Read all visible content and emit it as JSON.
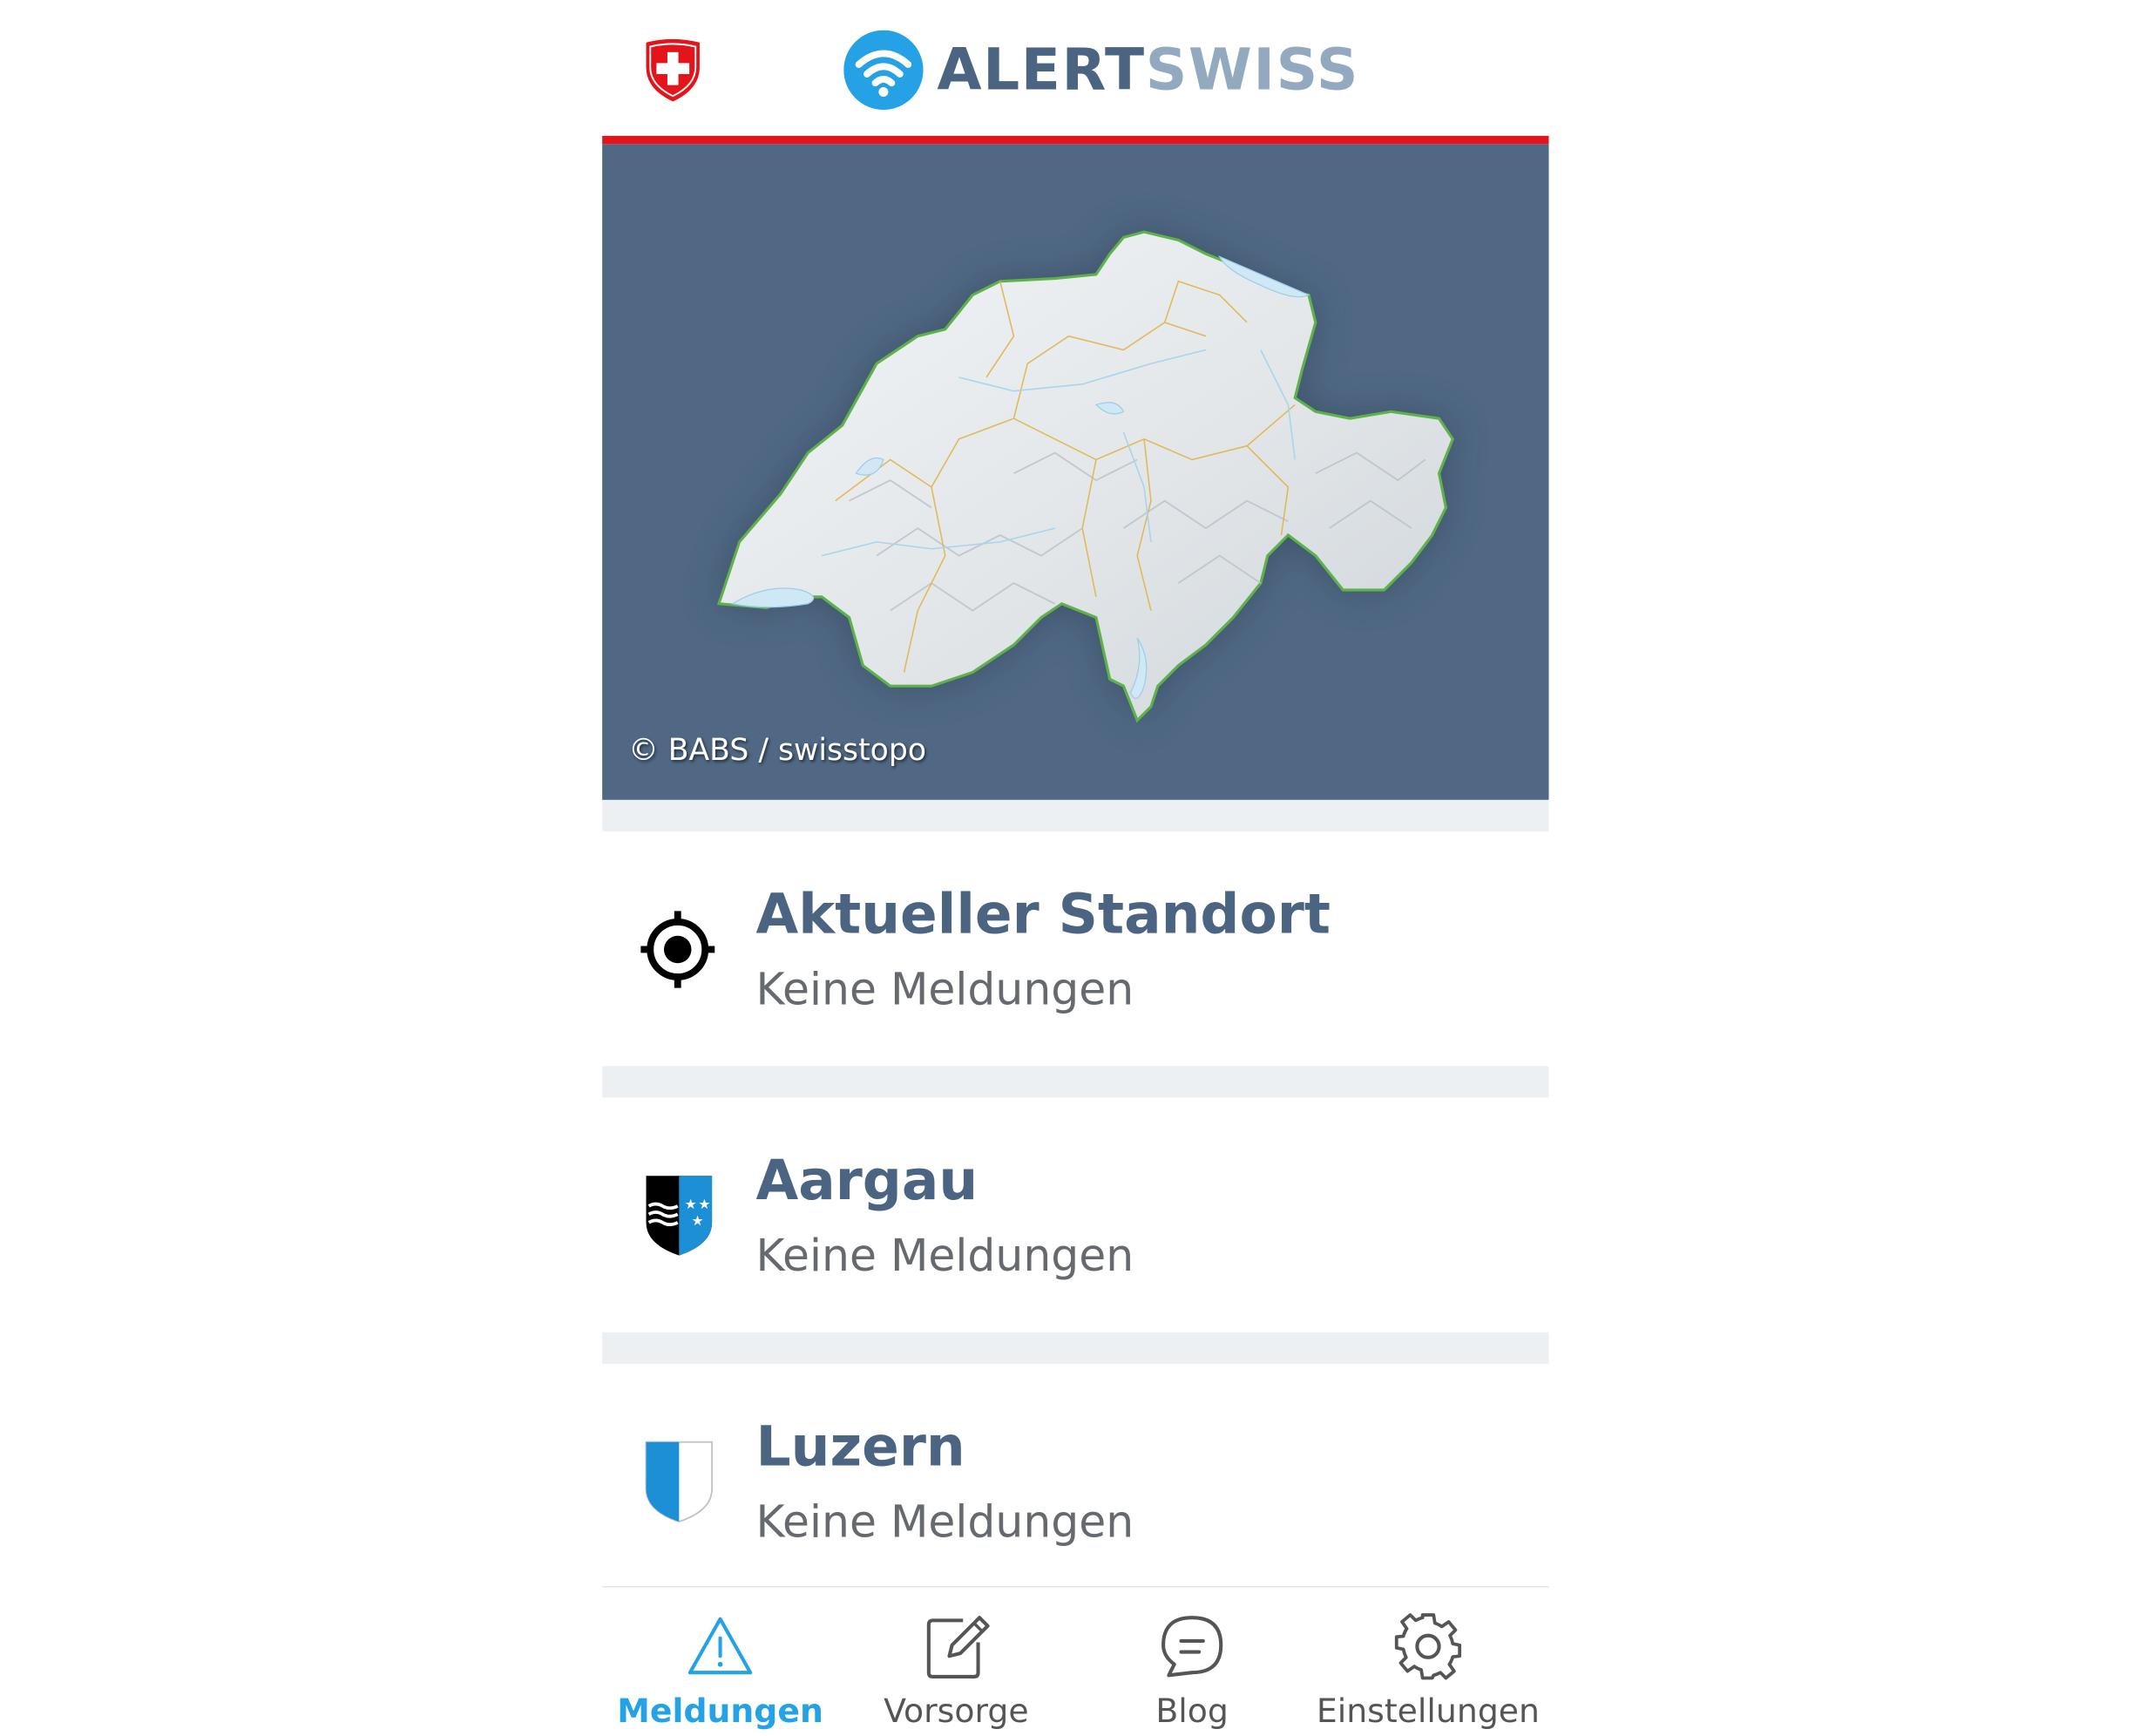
{
  "header": {
    "brand_part1": "ALERT",
    "brand_part2": "SWISS"
  },
  "map": {
    "credit": "© BABS / swisstopo"
  },
  "locations": [
    {
      "title": "Aktueller Standort",
      "subtitle": "Keine Meldungen",
      "icon": "crosshair-location-icon"
    },
    {
      "title": "Aargau",
      "subtitle": "Keine Meldungen",
      "icon": "aargau-coat-of-arms-icon"
    },
    {
      "title": "Luzern",
      "subtitle": "Keine Meldungen",
      "icon": "luzern-coat-of-arms-icon"
    }
  ],
  "nav": {
    "items": [
      {
        "label": "Meldungen",
        "icon": "warning-triangle-icon",
        "active": true
      },
      {
        "label": "Vorsorge",
        "icon": "edit-note-icon",
        "active": false
      },
      {
        "label": "Blog",
        "icon": "chat-bubble-icon",
        "active": false
      },
      {
        "label": "Einstellungen",
        "icon": "gear-icon",
        "active": false
      }
    ]
  },
  "colors": {
    "brand_dark": "#4a6482",
    "brand_light": "#93a9c0",
    "swiss_red": "#e4141b",
    "accent_blue": "#24a2e5",
    "map_background": "#506884"
  }
}
